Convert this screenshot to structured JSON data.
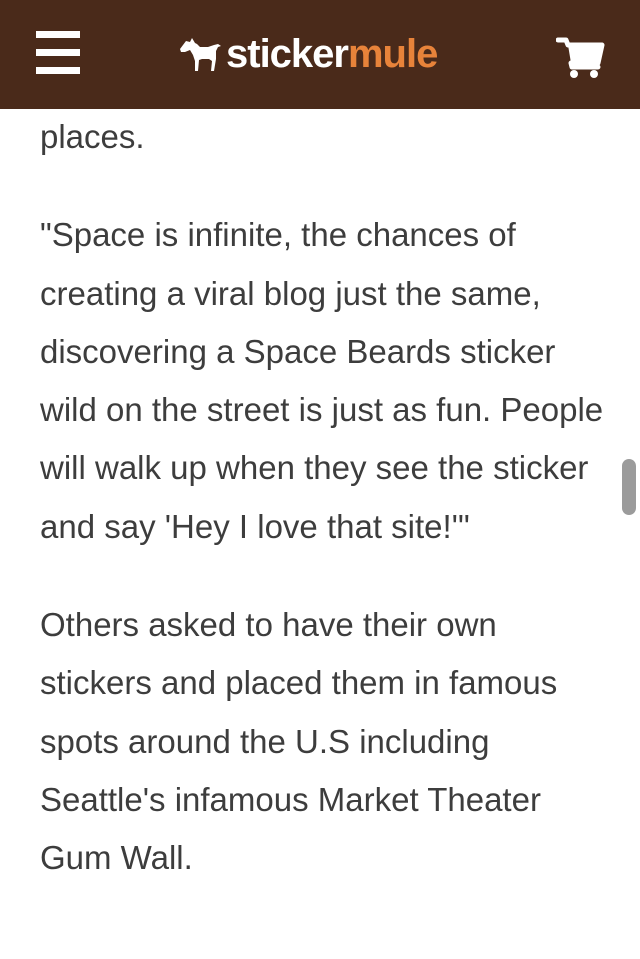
{
  "header": {
    "menu_icon": "hamburger-menu-icon",
    "logo_sticker": "sticker",
    "logo_mule": "mule",
    "logo_icon": "mule-horse-icon",
    "cart_icon": "shopping-cart-icon",
    "colors": {
      "bar": "#4a2a1a",
      "accent": "#e8833a",
      "text": "#ffffff"
    }
  },
  "article": {
    "paragraphs": [
      "places.",
      "\"Space is infinite, the chances of creating a viral blog just the same, discovering a Space Beards sticker wild on the street is just as fun. People will walk up when they see the sticker and say 'Hey I love that site!'\"",
      "Others asked to have their own stickers and placed them in famous spots around the U.S including Seattle's infamous Market Theater Gum Wall."
    ]
  }
}
